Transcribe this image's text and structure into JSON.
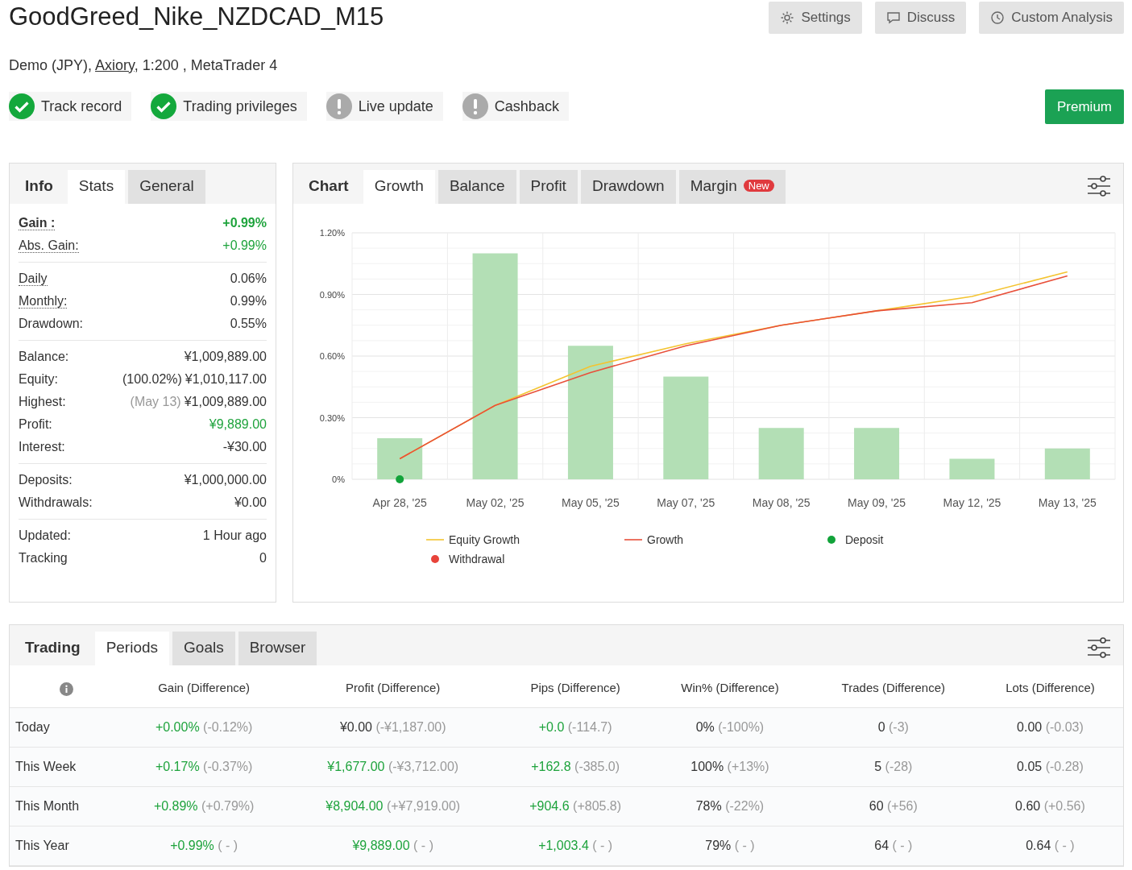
{
  "header": {
    "title": "GoodGreed_Nike_NZDCAD_M15",
    "subtitle": {
      "before": "Demo (JPY), ",
      "link": "Axiory",
      "after": ", 1:200 , MetaTrader 4"
    },
    "actions": [
      {
        "kind": "settings",
        "label": "Settings"
      },
      {
        "kind": "discuss",
        "label": "Discuss"
      },
      {
        "kind": "analysis",
        "label": "Custom Analysis"
      }
    ],
    "badges": [
      {
        "label": "Track record",
        "verified": true
      },
      {
        "label": "Trading privileges",
        "verified": true
      },
      {
        "label": "Live update",
        "verified": false
      },
      {
        "label": "Cashback",
        "verified": false
      }
    ],
    "premium_button": "Premium"
  },
  "info_panel": {
    "heading": "Info",
    "tabs": [
      {
        "label": "Stats",
        "selected": true
      },
      {
        "label": "General",
        "selected": false
      }
    ],
    "groups": [
      [
        {
          "label": "Gain :",
          "value": "+0.99%",
          "positive": true,
          "strong": true,
          "hint": true
        },
        {
          "label": "Abs. Gain:",
          "value": "+0.99%",
          "positive": true,
          "strong": false,
          "hint": true
        }
      ],
      [
        {
          "label": "Daily",
          "value": "0.06%",
          "positive": false,
          "strong": false,
          "hint": true
        },
        {
          "label": "Monthly:",
          "value": "0.99%",
          "positive": false,
          "strong": false,
          "hint": true
        },
        {
          "label": "Drawdown:",
          "value": "0.55%",
          "positive": false,
          "strong": false,
          "hint": false
        }
      ],
      [
        {
          "label": "Balance:",
          "value": "¥1,009,889.00",
          "positive": false,
          "strong": false,
          "hint": false
        },
        {
          "label": "Equity:",
          "note": "(100.02%)",
          "note_muted": false,
          "value": "¥1,010,117.00",
          "positive": false,
          "strong": false,
          "hint": false
        },
        {
          "label": "Highest:",
          "note": "(May 13)",
          "note_muted": true,
          "value": "¥1,009,889.00",
          "positive": false,
          "strong": false,
          "hint": false
        },
        {
          "label": "Profit:",
          "value": "¥9,889.00",
          "positive": true,
          "strong": false,
          "hint": false
        },
        {
          "label": "Interest:",
          "value": "-¥30.00",
          "positive": false,
          "strong": false,
          "hint": false
        }
      ],
      [
        {
          "label": "Deposits:",
          "value": "¥1,000,000.00",
          "positive": false,
          "strong": false,
          "hint": false
        },
        {
          "label": "Withdrawals:",
          "value": "¥0.00",
          "positive": false,
          "strong": false,
          "hint": false
        }
      ],
      [
        {
          "label": "Updated:",
          "value": "1 Hour ago",
          "positive": false,
          "strong": false,
          "hint": false
        },
        {
          "label": "Tracking",
          "value": "0",
          "positive": false,
          "strong": false,
          "hint": false
        }
      ]
    ]
  },
  "chart_panel": {
    "heading": "Chart",
    "tabs": [
      {
        "label": "Growth",
        "selected": true
      },
      {
        "label": "Balance",
        "selected": false
      },
      {
        "label": "Profit",
        "selected": false
      },
      {
        "label": "Drawdown",
        "selected": false
      },
      {
        "label": "Margin",
        "selected": false,
        "badge": "New"
      }
    ],
    "chart_data": {
      "type": "bar",
      "categories": [
        "Apr 28, '25",
        "May 02, '25",
        "May 05, '25",
        "May 07, '25",
        "May 08, '25",
        "May 09, '25",
        "May 12, '25",
        "May 13, '25"
      ],
      "values": [
        0.2,
        1.1,
        0.65,
        0.5,
        0.25,
        0.25,
        0.1,
        0.15
      ],
      "series": [
        {
          "name": "Equity Growth",
          "color": "#f4c430",
          "type": "line",
          "values": [
            0.1,
            0.36,
            0.55,
            0.66,
            0.75,
            0.82,
            0.89,
            1.01
          ]
        },
        {
          "name": "Growth",
          "color": "#e8503a",
          "type": "line",
          "values": [
            0.1,
            0.36,
            0.52,
            0.65,
            0.75,
            0.82,
            0.86,
            0.99
          ]
        },
        {
          "name": "Deposit",
          "color": "#12a33a",
          "type": "scatter",
          "values": [
            0,
            null,
            null,
            null,
            null,
            null,
            null,
            null
          ]
        },
        {
          "name": "Withdrawal",
          "color": "#e8433a",
          "type": "scatter",
          "values": [
            null,
            null,
            null,
            null,
            null,
            null,
            null,
            null
          ]
        }
      ],
      "ylim": [
        0,
        1.2
      ],
      "yticks": [
        {
          "value": 0,
          "label": "0%"
        },
        {
          "value": 0.3,
          "label": "0.30%"
        },
        {
          "value": 0.6,
          "label": "0.60%"
        },
        {
          "value": 0.9,
          "label": "0.90%"
        },
        {
          "value": 1.2,
          "label": "1.20%"
        }
      ],
      "grid": true,
      "legend": true
    }
  },
  "trading_panel": {
    "heading": "Trading",
    "tabs": [
      {
        "label": "Periods",
        "selected": true
      },
      {
        "label": "Goals",
        "selected": false
      },
      {
        "label": "Browser",
        "selected": false
      }
    ],
    "columns": [
      "Gain (Difference)",
      "Profit (Difference)",
      "Pips (Difference)",
      "Win% (Difference)",
      "Trades (Difference)",
      "Lots (Difference)"
    ],
    "rows": [
      {
        "period": "Today",
        "cells": [
          {
            "value": "+0.00%",
            "diff": "(-0.12%)",
            "positive": true
          },
          {
            "value": "¥0.00",
            "diff": "(-¥1,187.00)",
            "positive": false
          },
          {
            "value": "+0.0",
            "diff": "(-114.7)",
            "positive": true
          },
          {
            "value": "0%",
            "diff": "(-100%)",
            "positive": false
          },
          {
            "value": "0",
            "diff": "(-3)",
            "positive": false
          },
          {
            "value": "0.00",
            "diff": "(-0.03)",
            "positive": false
          }
        ]
      },
      {
        "period": "This Week",
        "cells": [
          {
            "value": "+0.17%",
            "diff": "(-0.37%)",
            "positive": true
          },
          {
            "value": "¥1,677.00",
            "diff": "(-¥3,712.00)",
            "positive": true
          },
          {
            "value": "+162.8",
            "diff": "(-385.0)",
            "positive": true
          },
          {
            "value": "100%",
            "diff": "(+13%)",
            "positive": false
          },
          {
            "value": "5",
            "diff": "(-28)",
            "positive": false
          },
          {
            "value": "0.05",
            "diff": "(-0.28)",
            "positive": false
          }
        ]
      },
      {
        "period": "This Month",
        "cells": [
          {
            "value": "+0.89%",
            "diff": "(+0.79%)",
            "positive": true
          },
          {
            "value": "¥8,904.00",
            "diff": "(+¥7,919.00)",
            "positive": true
          },
          {
            "value": "+904.6",
            "diff": "(+805.8)",
            "positive": true
          },
          {
            "value": "78%",
            "diff": "(-22%)",
            "positive": false
          },
          {
            "value": "60",
            "diff": "(+56)",
            "positive": false
          },
          {
            "value": "0.60",
            "diff": "(+0.56)",
            "positive": false
          }
        ]
      },
      {
        "period": "This Year",
        "cells": [
          {
            "value": "+0.99%",
            "diff": "( - )",
            "positive": true
          },
          {
            "value": "¥9,889.00",
            "diff": "( - )",
            "positive": true
          },
          {
            "value": "+1,003.4",
            "diff": "( - )",
            "positive": true
          },
          {
            "value": "79%",
            "diff": "( - )",
            "positive": false
          },
          {
            "value": "64",
            "diff": "( - )",
            "positive": false
          },
          {
            "value": "0.64",
            "diff": "( - )",
            "positive": false
          }
        ]
      }
    ]
  }
}
